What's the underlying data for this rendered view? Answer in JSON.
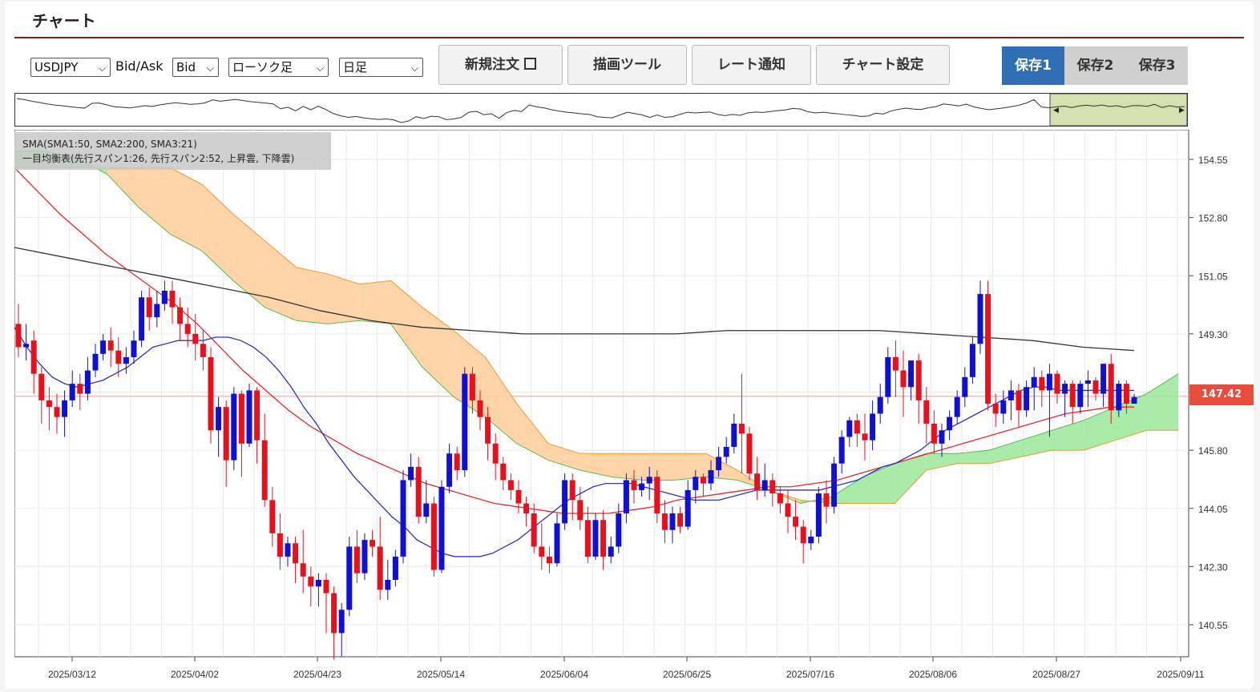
{
  "page": {
    "title": "チャート"
  },
  "toolbar": {
    "symbol": "USDJPY",
    "bidask_label": "Bid/Ask",
    "bidask_value": "Bid",
    "chart_type": "ローソク足",
    "period": "日足",
    "buttons": {
      "new_order": "新規注文",
      "draw_tools": "描画ツール",
      "rate_alert": "レート通知",
      "chart_settings": "チャート設定"
    },
    "saves": [
      {
        "label": "保存1",
        "active": true
      },
      {
        "label": "保存2",
        "active": false
      },
      {
        "label": "保存3",
        "active": false
      }
    ]
  },
  "legend": {
    "line1": "SMA(SMA1:50, SMA2:200, SMA3:21)",
    "line2": "一目均衡表(先行スパン1:26, 先行スパン2:52, 上昇雲, 下降雲)"
  },
  "current_price": "147.42",
  "colors": {
    "accent": "#8b1a1a",
    "save_active_bg": "#2f6eb5",
    "save_inactive_bg": "#d0d0d0",
    "candle_up": "#1010d0",
    "candle_down": "#e8101c",
    "sma50": "#e8292a",
    "sma200": "#333333",
    "sma21": "#3030c0",
    "cloud_up": "#9be89b",
    "cloud_down": "#ffcc99",
    "span1": "#55bb55",
    "span2": "#ee9933"
  },
  "chart_data": {
    "type": "candlestick",
    "y_ticks": [
      "154.55",
      "152.80",
      "151.05",
      "149.30",
      "147.55",
      "145.80",
      "144.05",
      "142.30",
      "140.55"
    ],
    "x_ticks": [
      "2025/03/12",
      "2025/04/02",
      "2025/04/23",
      "2025/05/14",
      "2025/06/04",
      "2025/06/25",
      "2025/07/16",
      "2025/08/06",
      "2025/08/27",
      "2025/09/11"
    ],
    "ylim": [
      140.0,
      155.0
    ],
    "candles": [
      {
        "o": 149.6,
        "h": 150.2,
        "c": 148.9,
        "l": 148.6
      },
      {
        "o": 148.9,
        "h": 149.6,
        "c": 149.0,
        "l": 148.5
      },
      {
        "o": 149.1,
        "h": 149.4,
        "c": 148.1,
        "l": 147.5
      },
      {
        "o": 148.1,
        "h": 148.3,
        "c": 147.3,
        "l": 146.6
      },
      {
        "o": 147.3,
        "h": 147.7,
        "c": 147.1,
        "l": 146.4
      },
      {
        "o": 147.1,
        "h": 147.5,
        "c": 146.8,
        "l": 146.3
      },
      {
        "o": 146.8,
        "h": 147.6,
        "c": 147.3,
        "l": 146.2
      },
      {
        "o": 147.3,
        "h": 148.2,
        "c": 147.8,
        "l": 147.1
      },
      {
        "o": 147.8,
        "h": 148.1,
        "c": 147.5,
        "l": 147.0
      },
      {
        "o": 147.5,
        "h": 148.6,
        "c": 148.2,
        "l": 147.3
      },
      {
        "o": 148.2,
        "h": 149.0,
        "c": 148.7,
        "l": 148.0
      },
      {
        "o": 148.7,
        "h": 149.3,
        "c": 149.1,
        "l": 148.5
      },
      {
        "o": 149.1,
        "h": 149.5,
        "c": 148.8,
        "l": 148.3
      },
      {
        "o": 148.8,
        "h": 149.2,
        "c": 148.4,
        "l": 148.0
      },
      {
        "o": 148.4,
        "h": 148.9,
        "c": 148.6,
        "l": 148.1
      },
      {
        "o": 148.6,
        "h": 149.4,
        "c": 149.1,
        "l": 148.4
      },
      {
        "o": 149.1,
        "h": 150.6,
        "c": 150.4,
        "l": 148.9
      },
      {
        "o": 150.4,
        "h": 150.7,
        "c": 149.8,
        "l": 149.4
      },
      {
        "o": 149.8,
        "h": 150.6,
        "c": 150.2,
        "l": 149.5
      },
      {
        "o": 150.2,
        "h": 150.9,
        "c": 150.6,
        "l": 150.0
      },
      {
        "o": 150.6,
        "h": 150.9,
        "c": 150.1,
        "l": 149.6
      },
      {
        "o": 150.1,
        "h": 150.4,
        "c": 149.6,
        "l": 149.1
      },
      {
        "o": 149.6,
        "h": 150.1,
        "c": 149.3,
        "l": 148.9
      },
      {
        "o": 149.3,
        "h": 149.9,
        "c": 149.0,
        "l": 148.5
      },
      {
        "o": 149.0,
        "h": 149.4,
        "c": 148.6,
        "l": 148.2
      },
      {
        "o": 148.6,
        "h": 148.9,
        "c": 146.4,
        "l": 146.0
      },
      {
        "o": 146.4,
        "h": 147.4,
        "c": 147.1,
        "l": 145.6
      },
      {
        "o": 147.1,
        "h": 147.3,
        "c": 145.5,
        "l": 144.7
      },
      {
        "o": 145.5,
        "h": 147.7,
        "c": 147.5,
        "l": 145.2
      },
      {
        "o": 147.5,
        "h": 147.6,
        "c": 146.0,
        "l": 145.0
      },
      {
        "o": 146.0,
        "h": 147.8,
        "c": 147.6,
        "l": 145.9
      },
      {
        "o": 147.6,
        "h": 147.7,
        "c": 146.1,
        "l": 145.4
      },
      {
        "o": 146.1,
        "h": 146.9,
        "c": 144.3,
        "l": 144.1
      },
      {
        "o": 144.3,
        "h": 144.7,
        "c": 143.3,
        "l": 142.9
      },
      {
        "o": 143.3,
        "h": 143.9,
        "c": 142.6,
        "l": 142.2
      },
      {
        "o": 142.6,
        "h": 143.2,
        "c": 143.0,
        "l": 142.3
      },
      {
        "o": 143.0,
        "h": 143.2,
        "c": 142.4,
        "l": 141.8
      },
      {
        "o": 142.4,
        "h": 143.4,
        "c": 142.0,
        "l": 141.5
      },
      {
        "o": 142.0,
        "h": 142.3,
        "c": 141.7,
        "l": 141.1
      },
      {
        "o": 141.7,
        "h": 142.1,
        "c": 141.9,
        "l": 141.1
      },
      {
        "o": 141.9,
        "h": 142.1,
        "c": 141.5,
        "l": 140.3
      },
      {
        "o": 141.5,
        "h": 141.7,
        "c": 140.3,
        "l": 139.5
      },
      {
        "o": 140.3,
        "h": 141.2,
        "c": 141.0,
        "l": 139.6
      },
      {
        "o": 141.0,
        "h": 143.2,
        "c": 142.9,
        "l": 140.8
      },
      {
        "o": 142.9,
        "h": 143.4,
        "c": 142.1,
        "l": 141.8
      },
      {
        "o": 142.1,
        "h": 143.3,
        "c": 143.1,
        "l": 141.9
      },
      {
        "o": 143.1,
        "h": 143.4,
        "c": 142.9,
        "l": 142.6
      },
      {
        "o": 142.9,
        "h": 143.8,
        "c": 141.6,
        "l": 141.3
      },
      {
        "o": 141.6,
        "h": 142.5,
        "c": 141.9,
        "l": 141.3
      },
      {
        "o": 141.9,
        "h": 142.8,
        "c": 142.6,
        "l": 141.7
      },
      {
        "o": 142.6,
        "h": 145.2,
        "c": 144.9,
        "l": 142.4
      },
      {
        "o": 144.9,
        "h": 145.7,
        "c": 145.3,
        "l": 144.7
      },
      {
        "o": 145.3,
        "h": 145.6,
        "c": 143.8,
        "l": 143.6
      },
      {
        "o": 143.8,
        "h": 144.9,
        "c": 144.2,
        "l": 143.6
      },
      {
        "o": 144.2,
        "h": 144.4,
        "c": 142.2,
        "l": 142.0
      },
      {
        "o": 142.2,
        "h": 144.9,
        "c": 144.7,
        "l": 142.1
      },
      {
        "o": 144.7,
        "h": 146.0,
        "c": 145.7,
        "l": 144.5
      },
      {
        "o": 145.7,
        "h": 145.9,
        "c": 145.2,
        "l": 144.9
      },
      {
        "o": 145.2,
        "h": 148.3,
        "c": 148.1,
        "l": 145.0
      },
      {
        "o": 148.1,
        "h": 148.3,
        "c": 147.3,
        "l": 146.9
      },
      {
        "o": 147.3,
        "h": 147.6,
        "c": 146.8,
        "l": 146.4
      },
      {
        "o": 146.8,
        "h": 147.1,
        "c": 146.0,
        "l": 145.5
      },
      {
        "o": 146.0,
        "h": 146.3,
        "c": 145.4,
        "l": 144.9
      },
      {
        "o": 145.4,
        "h": 145.6,
        "c": 144.9,
        "l": 144.6
      },
      {
        "o": 144.9,
        "h": 145.1,
        "c": 144.6,
        "l": 144.3
      },
      {
        "o": 144.6,
        "h": 144.9,
        "c": 144.2,
        "l": 143.9
      },
      {
        "o": 144.2,
        "h": 144.4,
        "c": 143.9,
        "l": 143.5
      },
      {
        "o": 143.9,
        "h": 144.2,
        "c": 142.9,
        "l": 142.7
      },
      {
        "o": 142.9,
        "h": 143.6,
        "c": 142.6,
        "l": 142.2
      },
      {
        "o": 142.6,
        "h": 142.9,
        "c": 142.4,
        "l": 142.1
      },
      {
        "o": 142.4,
        "h": 143.9,
        "c": 143.6,
        "l": 142.3
      },
      {
        "o": 143.6,
        "h": 145.1,
        "c": 144.9,
        "l": 143.4
      },
      {
        "o": 144.9,
        "h": 145.1,
        "c": 144.3,
        "l": 143.7
      },
      {
        "o": 144.3,
        "h": 144.7,
        "c": 143.7,
        "l": 143.4
      },
      {
        "o": 143.7,
        "h": 144.1,
        "c": 142.6,
        "l": 142.4
      },
      {
        "o": 142.6,
        "h": 143.9,
        "c": 143.7,
        "l": 142.5
      },
      {
        "o": 143.7,
        "h": 144.0,
        "c": 142.6,
        "l": 142.2
      },
      {
        "o": 142.6,
        "h": 143.2,
        "c": 142.9,
        "l": 142.4
      },
      {
        "o": 142.9,
        "h": 144.2,
        "c": 143.9,
        "l": 142.7
      },
      {
        "o": 143.9,
        "h": 145.1,
        "c": 144.9,
        "l": 143.6
      },
      {
        "o": 144.9,
        "h": 145.2,
        "c": 144.6,
        "l": 144.2
      },
      {
        "o": 144.6,
        "h": 145.0,
        "c": 144.8,
        "l": 144.4
      },
      {
        "o": 144.8,
        "h": 145.3,
        "c": 145.0,
        "l": 144.3
      },
      {
        "o": 145.0,
        "h": 145.2,
        "c": 143.9,
        "l": 143.6
      },
      {
        "o": 143.9,
        "h": 144.3,
        "c": 143.4,
        "l": 143.0
      },
      {
        "o": 143.4,
        "h": 144.1,
        "c": 143.9,
        "l": 143.0
      },
      {
        "o": 143.9,
        "h": 144.1,
        "c": 143.5,
        "l": 143.3
      },
      {
        "o": 143.5,
        "h": 144.9,
        "c": 144.6,
        "l": 143.4
      },
      {
        "o": 144.6,
        "h": 145.2,
        "c": 145.0,
        "l": 144.2
      },
      {
        "o": 145.0,
        "h": 145.1,
        "c": 144.8,
        "l": 144.4
      },
      {
        "o": 144.8,
        "h": 145.5,
        "c": 145.2,
        "l": 144.6
      },
      {
        "o": 145.2,
        "h": 145.9,
        "c": 145.6,
        "l": 145.0
      },
      {
        "o": 145.6,
        "h": 146.2,
        "c": 145.9,
        "l": 145.4
      },
      {
        "o": 145.9,
        "h": 146.9,
        "c": 146.6,
        "l": 145.7
      },
      {
        "o": 146.6,
        "h": 148.1,
        "c": 146.3,
        "l": 145.1
      },
      {
        "o": 146.3,
        "h": 146.5,
        "c": 145.1,
        "l": 144.9
      },
      {
        "o": 145.1,
        "h": 145.6,
        "c": 144.6,
        "l": 144.3
      },
      {
        "o": 144.6,
        "h": 145.4,
        "c": 144.9,
        "l": 144.4
      },
      {
        "o": 144.9,
        "h": 145.1,
        "c": 144.5,
        "l": 144.1
      },
      {
        "o": 144.5,
        "h": 144.7,
        "c": 144.2,
        "l": 143.9
      },
      {
        "o": 144.2,
        "h": 144.6,
        "c": 143.8,
        "l": 143.3
      },
      {
        "o": 143.8,
        "h": 144.3,
        "c": 143.5,
        "l": 143.1
      },
      {
        "o": 143.5,
        "h": 143.7,
        "c": 143.0,
        "l": 142.4
      },
      {
        "o": 143.0,
        "h": 143.4,
        "c": 143.2,
        "l": 142.8
      },
      {
        "o": 143.2,
        "h": 144.7,
        "c": 144.5,
        "l": 143.0
      },
      {
        "o": 144.5,
        "h": 144.9,
        "c": 144.1,
        "l": 143.6
      },
      {
        "o": 144.1,
        "h": 145.6,
        "c": 145.4,
        "l": 143.9
      },
      {
        "o": 145.4,
        "h": 146.4,
        "c": 146.2,
        "l": 145.1
      },
      {
        "o": 146.2,
        "h": 146.8,
        "c": 146.7,
        "l": 145.9
      },
      {
        "o": 146.7,
        "h": 146.9,
        "c": 146.3,
        "l": 145.9
      },
      {
        "o": 146.3,
        "h": 146.9,
        "c": 146.1,
        "l": 145.5
      },
      {
        "o": 146.1,
        "h": 147.3,
        "c": 146.9,
        "l": 145.8
      },
      {
        "o": 146.9,
        "h": 147.8,
        "c": 147.4,
        "l": 146.6
      },
      {
        "o": 147.4,
        "h": 148.9,
        "c": 148.6,
        "l": 147.2
      },
      {
        "o": 148.6,
        "h": 149.1,
        "c": 148.2,
        "l": 147.4
      },
      {
        "o": 148.2,
        "h": 148.8,
        "c": 147.7,
        "l": 146.8
      },
      {
        "o": 147.7,
        "h": 148.4,
        "c": 148.5,
        "l": 147.3
      },
      {
        "o": 148.5,
        "h": 148.7,
        "c": 147.3,
        "l": 146.6
      },
      {
        "o": 147.3,
        "h": 147.7,
        "c": 146.6,
        "l": 146.0
      },
      {
        "o": 146.6,
        "h": 147.0,
        "c": 146.0,
        "l": 145.7
      },
      {
        "o": 146.0,
        "h": 146.6,
        "c": 146.4,
        "l": 145.6
      },
      {
        "o": 146.4,
        "h": 147.0,
        "c": 146.8,
        "l": 146.1
      },
      {
        "o": 146.8,
        "h": 147.6,
        "c": 147.4,
        "l": 146.6
      },
      {
        "o": 147.4,
        "h": 148.3,
        "c": 148.0,
        "l": 147.1
      },
      {
        "o": 148.0,
        "h": 149.2,
        "c": 149.0,
        "l": 147.8
      },
      {
        "o": 149.0,
        "h": 150.9,
        "c": 150.5,
        "l": 148.7
      },
      {
        "o": 150.5,
        "h": 150.9,
        "c": 147.2,
        "l": 147.0
      },
      {
        "o": 147.2,
        "h": 147.5,
        "c": 146.9,
        "l": 146.5
      },
      {
        "o": 146.9,
        "h": 147.6,
        "c": 147.3,
        "l": 146.6
      },
      {
        "o": 147.3,
        "h": 147.9,
        "c": 147.6,
        "l": 146.7
      },
      {
        "o": 147.6,
        "h": 147.8,
        "c": 147.0,
        "l": 146.5
      },
      {
        "o": 147.0,
        "h": 147.9,
        "c": 147.7,
        "l": 146.8
      },
      {
        "o": 147.7,
        "h": 148.3,
        "c": 148.0,
        "l": 147.0
      },
      {
        "o": 148.0,
        "h": 148.2,
        "c": 147.6,
        "l": 147.1
      },
      {
        "o": 147.6,
        "h": 148.4,
        "c": 148.1,
        "l": 146.2
      },
      {
        "o": 148.1,
        "h": 148.2,
        "c": 147.5,
        "l": 147.2
      },
      {
        "o": 147.5,
        "h": 147.9,
        "c": 147.8,
        "l": 146.8
      },
      {
        "o": 147.8,
        "h": 147.9,
        "c": 147.1,
        "l": 146.6
      },
      {
        "o": 147.1,
        "h": 147.9,
        "c": 147.8,
        "l": 146.9
      },
      {
        "o": 147.8,
        "h": 148.2,
        "c": 147.9,
        "l": 147.1
      },
      {
        "o": 147.9,
        "h": 148.0,
        "c": 147.5,
        "l": 147.3
      },
      {
        "o": 147.5,
        "h": 148.4,
        "c": 148.4,
        "l": 147.1
      },
      {
        "o": 148.4,
        "h": 148.7,
        "c": 147.0,
        "l": 146.6
      },
      {
        "o": 147.0,
        "h": 147.9,
        "c": 147.8,
        "l": 146.8
      },
      {
        "o": 147.8,
        "h": 147.9,
        "c": 147.2,
        "l": 146.9
      },
      {
        "o": 147.2,
        "h": 147.5,
        "c": 147.4,
        "l": 147.2
      }
    ],
    "sma21": [
      149.5,
      148.9,
      148.4,
      148.0,
      147.8,
      147.7,
      147.8,
      147.9,
      148.1,
      148.3,
      148.6,
      148.9,
      149.0,
      149.1,
      149.1,
      149.1,
      149.2,
      149.2,
      149.1,
      148.9,
      148.6,
      148.2,
      147.7,
      147.1,
      146.6,
      146.0,
      145.5,
      145.0,
      144.6,
      144.2,
      143.8,
      143.5,
      143.1,
      142.9,
      142.7,
      142.6,
      142.6,
      142.6,
      142.7,
      142.9,
      143.1,
      143.4,
      143.7,
      144.0,
      144.3,
      144.5,
      144.7,
      144.8,
      144.8,
      144.8,
      144.7,
      144.6,
      144.5,
      144.4,
      144.3,
      144.3,
      144.3,
      144.4,
      144.5,
      144.6,
      144.6,
      144.6,
      144.6,
      144.6,
      144.6,
      144.7,
      144.8,
      144.9,
      145.1,
      145.3,
      145.4,
      145.6,
      145.8,
      146.1,
      146.4,
      146.6,
      146.8,
      147.0,
      147.2,
      147.4,
      147.6,
      147.7,
      147.7,
      147.6,
      147.6,
      147.6,
      147.6,
      147.6,
      147.6,
      147.6
    ],
    "sma50": [
      154.3,
      153.6,
      152.9,
      152.3,
      151.7,
      151.2,
      150.7,
      150.2,
      149.6,
      148.9,
      148.2,
      147.6,
      147.0,
      146.5,
      146.1,
      145.7,
      145.4,
      145.1,
      144.8,
      144.6,
      144.4,
      144.2,
      144.1,
      144.0,
      143.9,
      143.9,
      143.9,
      144.0,
      144.1,
      144.3,
      144.4,
      144.5,
      144.6,
      144.7,
      144.7,
      144.8,
      144.9,
      145.1,
      145.3,
      145.5,
      145.7,
      145.9,
      146.1,
      146.3,
      146.5,
      146.7,
      146.9,
      147.0,
      147.1,
      147.1
    ],
    "sma200": [
      151.9,
      151.6,
      151.3,
      151.0,
      150.7,
      150.4,
      150.0,
      149.7,
      149.5,
      149.4,
      149.3,
      149.3,
      149.3,
      149.3,
      149.4,
      149.4,
      149.4,
      149.4,
      149.3,
      149.2,
      149.1,
      148.9,
      148.8
    ],
    "span1": [
      154.8,
      154.8,
      154.6,
      154.1,
      153.1,
      152.3,
      151.8,
      150.9,
      150.1,
      149.7,
      149.6,
      149.7,
      149.6,
      148.3,
      147.4,
      146.8,
      146.0,
      145.5,
      145.2,
      145.0,
      144.9,
      144.9,
      145.0,
      144.9,
      144.6,
      144.2,
      144.4,
      145.0,
      145.4,
      145.7,
      145.7,
      145.8,
      146.1,
      146.4,
      146.7,
      147.1,
      147.5,
      148.1
    ],
    "span2": [
      154.3,
      154.3,
      154.3,
      154.3,
      154.3,
      154.3,
      153.8,
      152.9,
      152.1,
      151.3,
      151.1,
      150.8,
      150.9,
      150.1,
      149.4,
      148.6,
      147.2,
      146.0,
      145.7,
      145.7,
      145.7,
      145.7,
      145.7,
      145.2,
      144.6,
      144.3,
      144.2,
      144.2,
      144.2,
      145.2,
      145.4,
      145.4,
      145.6,
      145.8,
      145.8,
      146.1,
      146.4,
      146.4
    ]
  }
}
